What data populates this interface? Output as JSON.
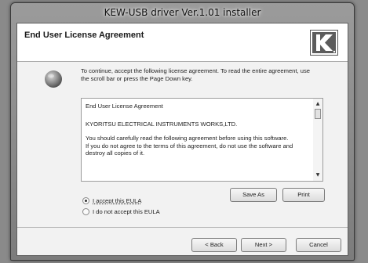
{
  "window": {
    "title": "KEW-USB driver Ver.1.01 installer"
  },
  "header": {
    "title": "End User License Agreement",
    "logo_icon": "kyoritsu-logo"
  },
  "instructions": "To continue, accept the following license agreement. To read the entire agreement, use the scroll bar or press the Page Down key.",
  "eula": {
    "line1": "End User License Agreement",
    "line2": "KYORITSU ELECTRICAL INSTRUMENTS WORKS,LTD.",
    "line3": "You should carefully read the following agreement before using this software.",
    "line4": "If you do not agree to the terms of this agreement, do not use the software and destroy all copies of it."
  },
  "options": {
    "accept": "I accept this EULA",
    "decline": "I do not accept this EULA",
    "selected": "accept"
  },
  "buttons": {
    "save_as": "Save As",
    "print": "Print",
    "back": "< Back",
    "next": "Next >",
    "cancel": "Cancel"
  }
}
